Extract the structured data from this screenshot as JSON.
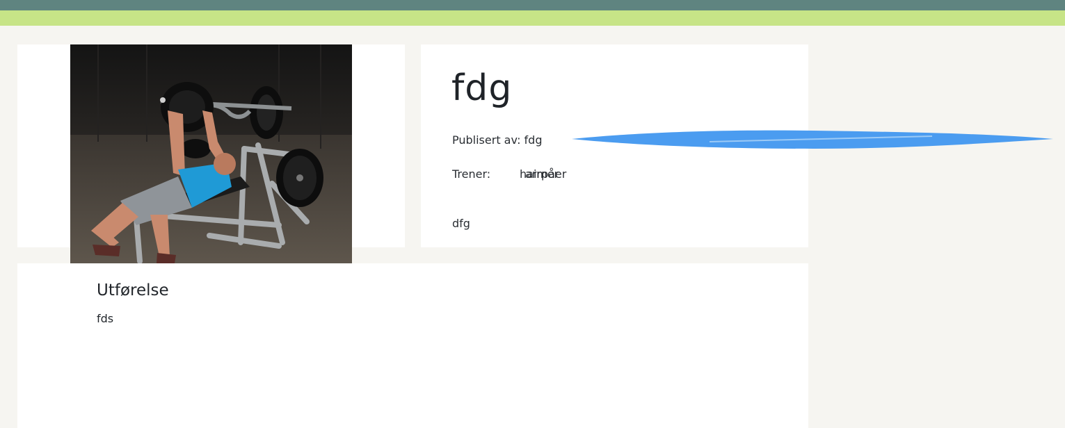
{
  "exercise": {
    "title": "fdg",
    "published_by": "Publisert av: fdg",
    "trainer_label": "Trener:",
    "trainer_names": [
      "hairpåer",
      "armer"
    ],
    "short_description": "dfg",
    "image_icon": "bench-press-photo"
  },
  "execution": {
    "heading": "Utførelse",
    "text": "fds"
  },
  "colors": {
    "topbar_dark": "#5f8480",
    "topbar_light": "#c7e487",
    "page_background": "#f6f5f1",
    "redaction_scribble": "#4b9cf0"
  }
}
